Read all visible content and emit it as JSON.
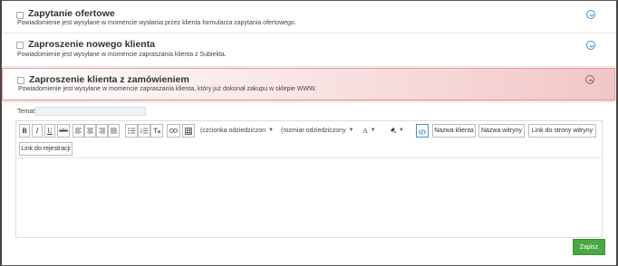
{
  "notifications": [
    {
      "title": "Zapytanie ofertowe",
      "description": "Powiadomienie jest wysyłane w momencie wysłania przez klienta formularza zapytania ofertowego."
    },
    {
      "title": "Zaproszenie nowego klienta",
      "description": "Powiadomienie jest wysyłane w momencie zapraszania klienta z Subiekta."
    },
    {
      "title": "Zaproszenie klienta z zamówieniem",
      "description": "Powiadomienie jest wysyłane w momencie zapraszania klienta, który już dokonał zakupu w sklepie WWW."
    }
  ],
  "form": {
    "subject_label": "Temat:",
    "subject_value": ""
  },
  "toolbar": {
    "bold": "B",
    "italic": "I",
    "underline": "U",
    "strike": "abc",
    "font_select": "(czcionka odziedziczon",
    "size_select": "(rozmiar odziedziczony",
    "font_color": "A",
    "insert_buttons": [
      "Nazwa klienta",
      "Nazwa witryny",
      "Link do strony witryny",
      "Link do rejestracji"
    ]
  },
  "actions": {
    "save_label": "Zapisz"
  },
  "colors": {
    "accent": "#3b8ed8",
    "save": "#4aa844",
    "highlight": "#f2c6c6"
  },
  "icons": [
    "collapse-toggle-icon",
    "align-left-icon",
    "align-center-icon",
    "align-right-icon",
    "justify-icon",
    "bullet-list-icon",
    "numbered-list-icon",
    "clear-format-icon",
    "link-icon",
    "table-icon",
    "background-color-icon",
    "code-view-icon"
  ]
}
